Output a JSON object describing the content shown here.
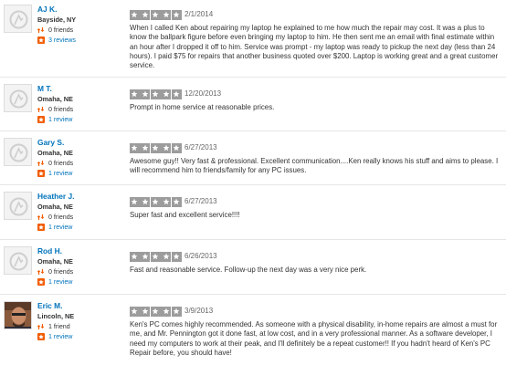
{
  "reviews": [
    {
      "name": "AJ K.",
      "location": "Bayside, NY",
      "friends": "0 friends",
      "reviews_count": "3 reviews",
      "rating": 5,
      "date": "2/1/2014",
      "text": "When I called Ken about repairing my laptop he explained to me how much the repair may cost. It was a plus to know the ballpark figure before even bringing my laptop to him. He then sent me an email with final estimate within an hour after I dropped it off to him. Service was prompt - my laptop was ready to pickup the next day (less than 24 hours). I paid $75 for repairs that another business quoted over $200. Laptop is working great and a great customer service.",
      "avatar": "default-avatar"
    },
    {
      "name": "M T.",
      "location": "Omaha, NE",
      "friends": "0 friends",
      "reviews_count": "1 review",
      "rating": 5,
      "date": "12/20/2013",
      "text": "Prompt in home service at reasonable prices.",
      "avatar": "default-avatar"
    },
    {
      "name": "Gary S.",
      "location": "Omaha, NE",
      "friends": "0 friends",
      "reviews_count": "1 review",
      "rating": 5,
      "date": "6/27/2013",
      "text": "Awesome guy!!  Very fast & professional.  Excellent communication....Ken really knows his stuff and aims to please.  I will recommend him to friends/family for any PC issues.",
      "avatar": "default-avatar"
    },
    {
      "name": "Heather J.",
      "location": "Omaha, NE",
      "friends": "0 friends",
      "reviews_count": "1 review",
      "rating": 5,
      "date": "6/27/2013",
      "text": "Super fast and excellent service!!!!",
      "avatar": "default-avatar"
    },
    {
      "name": "Rod H.",
      "location": "Omaha, NE",
      "friends": "0 friends",
      "reviews_count": "1 review",
      "rating": 5,
      "date": "6/26/2013",
      "text": "Fast and reasonable service.  Follow-up the next day was a very nice perk.",
      "avatar": "default-avatar"
    },
    {
      "name": "Eric M.",
      "location": "Lincoln, NE",
      "friends": "1 friend",
      "reviews_count": "1 review",
      "rating": 5,
      "date": "3/9/2013",
      "text": "Ken's PC comes highly recommended. As someone with a physical disability, in-home repairs are almost a must for me, and Mr. Pennington got it done fast, at low cost, and in a very professional manner. As a software developer, I need my computers to work at their peak, and I'll definitely be a repeat customer!! If you hadn't heard of Ken's PC Repair before, you should have!",
      "avatar": "photo-avatar"
    }
  ],
  "colors": {
    "link": "#0073bb",
    "star_bg": "#9c9c9c",
    "friends_icon": "#f15c00",
    "review_icon": "#f15c00"
  }
}
